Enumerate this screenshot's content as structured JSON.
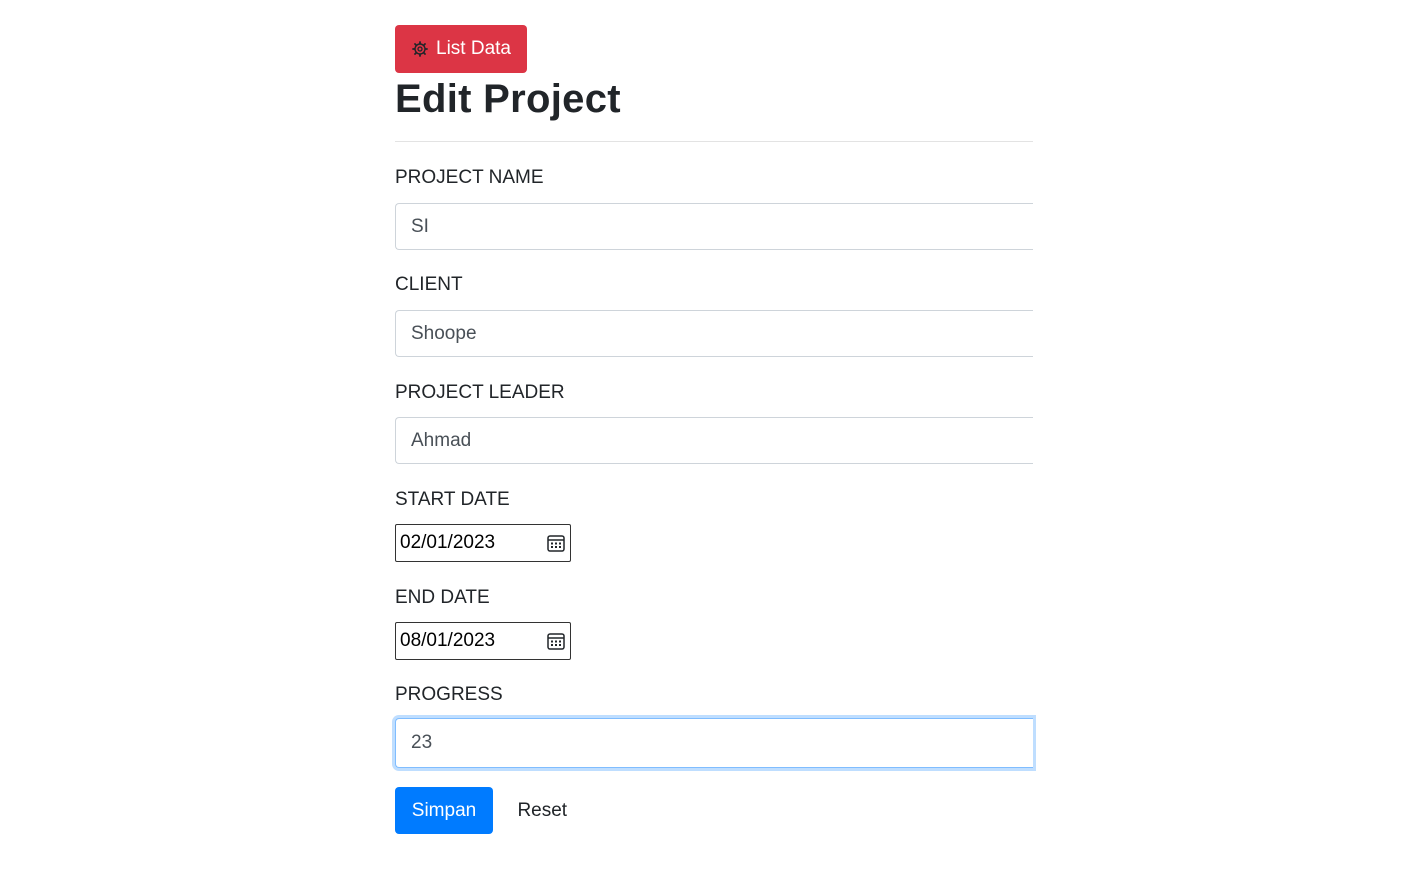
{
  "header": {
    "list_button_label": "List Data",
    "list_button_icon": "gear-icon",
    "title": "Edit Project"
  },
  "form": {
    "project_name": {
      "label": "PROJECT NAME",
      "value": "SI"
    },
    "client": {
      "label": "CLIENT",
      "value": "Shoope"
    },
    "project_leader": {
      "label": "PROJECT LEADER",
      "value": "Ahmad"
    },
    "start_date": {
      "label": "START DATE",
      "value": "02/01/2023"
    },
    "end_date": {
      "label": "END DATE",
      "value": "08/01/2023"
    },
    "progress": {
      "label": "PROGRESS",
      "value": "23"
    },
    "submit_label": "Simpan",
    "reset_label": "Reset"
  },
  "colors": {
    "danger": "#dc3545",
    "primary": "#007bff",
    "focus_border": "#80bdff"
  }
}
